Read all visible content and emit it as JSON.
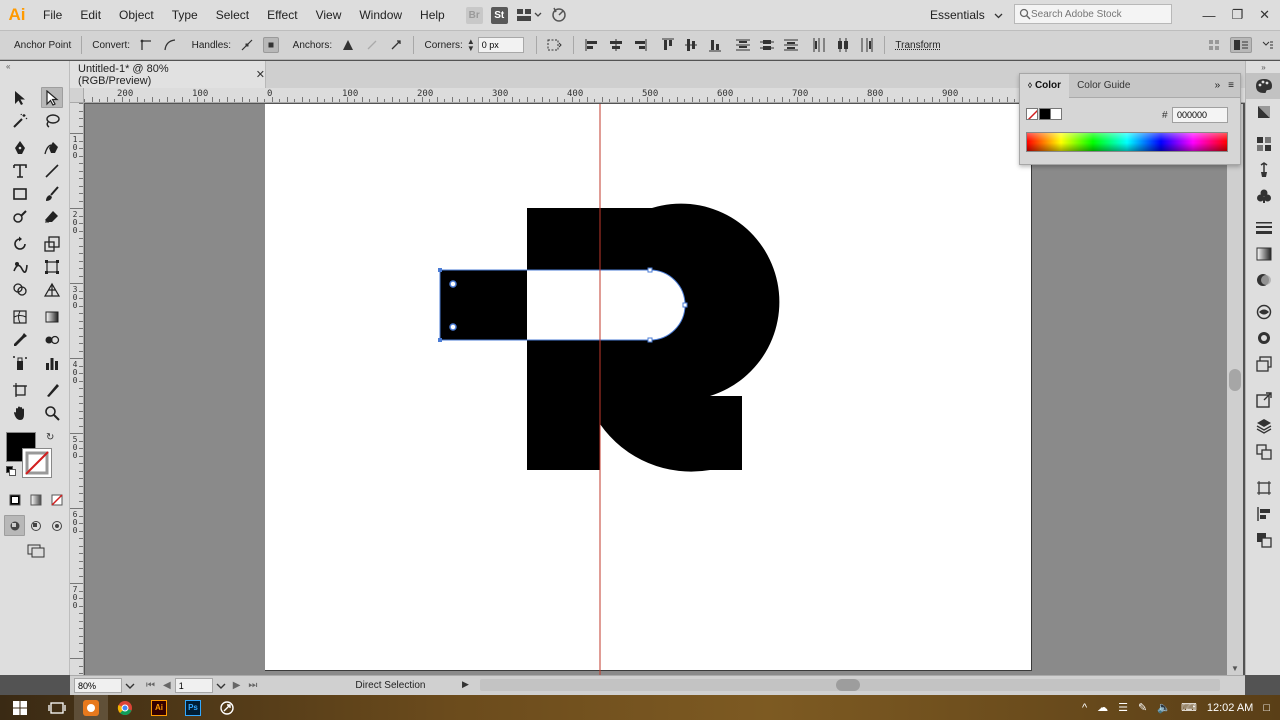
{
  "app": {
    "logo": "Ai",
    "workspace": "Essentials",
    "search_placeholder": "Search Adobe Stock"
  },
  "menu": [
    "File",
    "Edit",
    "Object",
    "Type",
    "Select",
    "Effect",
    "View",
    "Window",
    "Help"
  ],
  "menubar_icons": {
    "bridge": "Br",
    "stock": "St"
  },
  "control": {
    "tool_label": "Anchor Point",
    "convert_label": "Convert:",
    "handles_label": "Handles:",
    "anchors_label": "Anchors:",
    "corners_label": "Corners:",
    "corners_value": "0 px",
    "transform_label": "Transform"
  },
  "document": {
    "tab_title": "Untitled-1* @ 80% (RGB/Preview)",
    "close": "✕"
  },
  "rulers": {
    "top_labels": [
      "200",
      "100",
      "0",
      "100",
      "200",
      "300",
      "400",
      "500",
      "600",
      "700",
      "800",
      "900"
    ],
    "left_labels": [
      "1\n0\n0",
      "2\n0\n0",
      "3\n0\n0",
      "4\n0\n0",
      "5\n0\n0",
      "6\n0\n0",
      "7\n0\n0"
    ]
  },
  "color_panel": {
    "tab_color": "Color",
    "tab_guide": "Color Guide",
    "hex_label": "#",
    "hex_value": "000000"
  },
  "status": {
    "zoom": "80%",
    "page": "1",
    "status_text": "Direct Selection"
  },
  "taskbar": {
    "time": "12:02 AM",
    "badges": {
      "illustrator": "Ai",
      "photoshop": "Ps"
    }
  },
  "colors": {
    "accent": "#ff9a00",
    "fill": "#000000",
    "guide": "#c0392b",
    "selection": "#4a7bd4"
  }
}
